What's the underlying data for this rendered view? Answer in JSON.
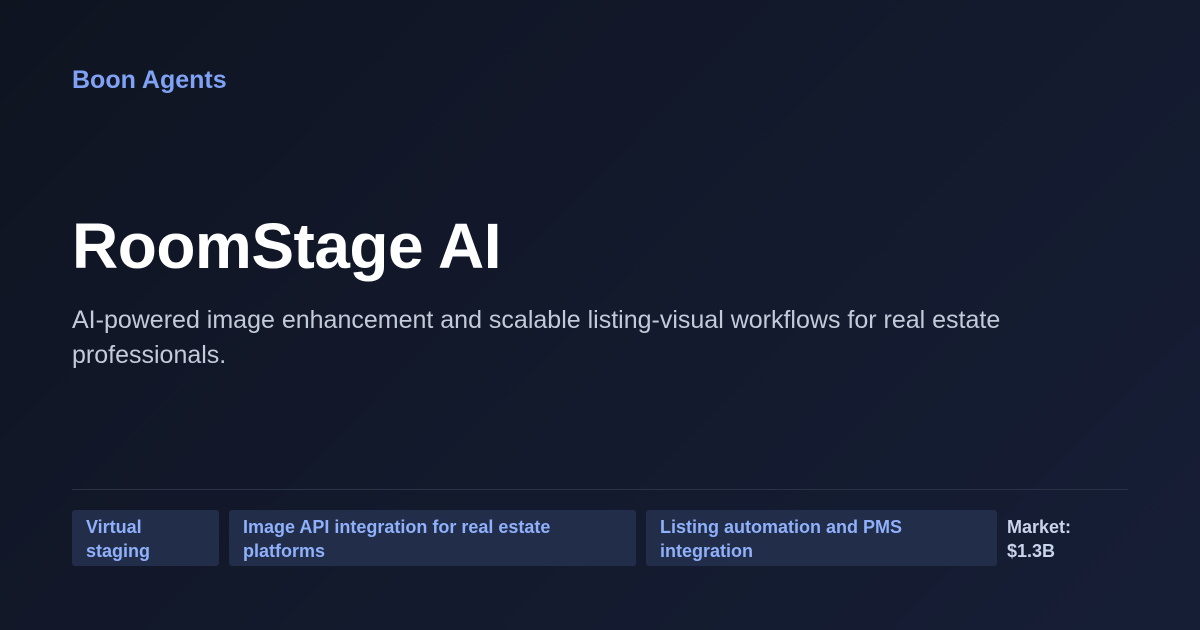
{
  "brand": {
    "name": "Boon Agents"
  },
  "hero": {
    "title": "RoomStage AI",
    "subtitle": "AI-powered image enhancement and scalable listing-visual workflows for real estate professionals."
  },
  "tags": [
    {
      "label": "Virtual staging"
    },
    {
      "label": "Image API integration for real estate platforms"
    },
    {
      "label": "Listing automation and PMS integration"
    }
  ],
  "market": {
    "label": "Market: $1.3B"
  },
  "colors": {
    "accent": "#7fa2f5",
    "tag_background": "#222d4a",
    "background": "#131a2d"
  }
}
